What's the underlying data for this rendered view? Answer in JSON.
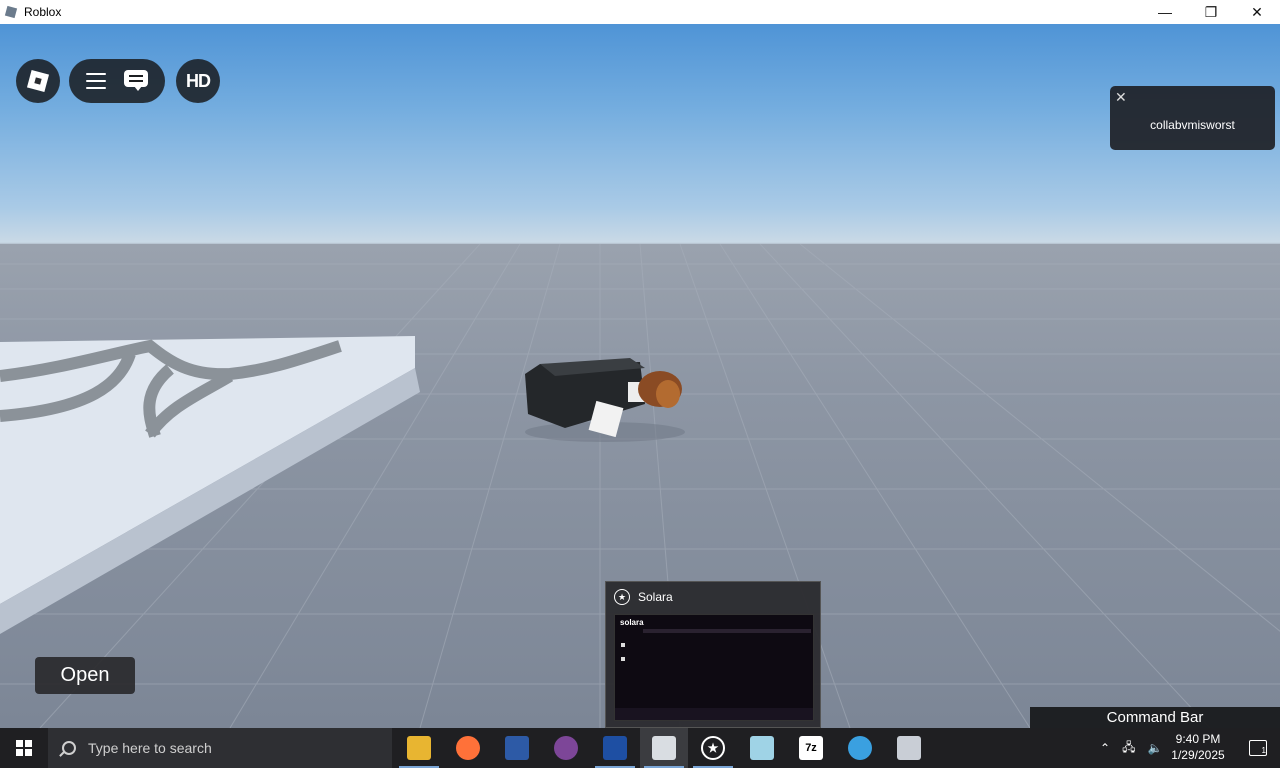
{
  "window": {
    "title": "Roblox"
  },
  "window_controls": {
    "minimize": "—",
    "maximize": "❐",
    "close": "✕"
  },
  "roblox_ui": {
    "hd_label": "HD",
    "player_card": {
      "close": "✕",
      "name": "collabvmisworst"
    },
    "open_button": "Open",
    "command_bar": "Command Bar"
  },
  "solara_preview": {
    "title": "Solara",
    "thumb_title": "solara"
  },
  "taskbar": {
    "search_placeholder": "Type here to search",
    "apps": [
      {
        "name": "file-explorer-icon"
      },
      {
        "name": "firefox-icon"
      },
      {
        "name": "game-icon"
      },
      {
        "name": "tor-browser-icon"
      },
      {
        "name": "app-s-icon"
      },
      {
        "name": "roblox-icon",
        "active": true
      },
      {
        "name": "solara-icon"
      },
      {
        "name": "app-cube-icon"
      },
      {
        "name": "7zip-icon",
        "label": "7z"
      },
      {
        "name": "internet-explorer-icon"
      },
      {
        "name": "app-window-icon"
      }
    ],
    "clock": {
      "time": "9:40 PM",
      "date": "1/29/2025"
    },
    "notifications_badge": "1"
  },
  "colors": {
    "sky_top": "#4f94d6",
    "ground": "#8a93a2",
    "taskbar": "#1f1f22",
    "accent": "#7aa5d6"
  }
}
